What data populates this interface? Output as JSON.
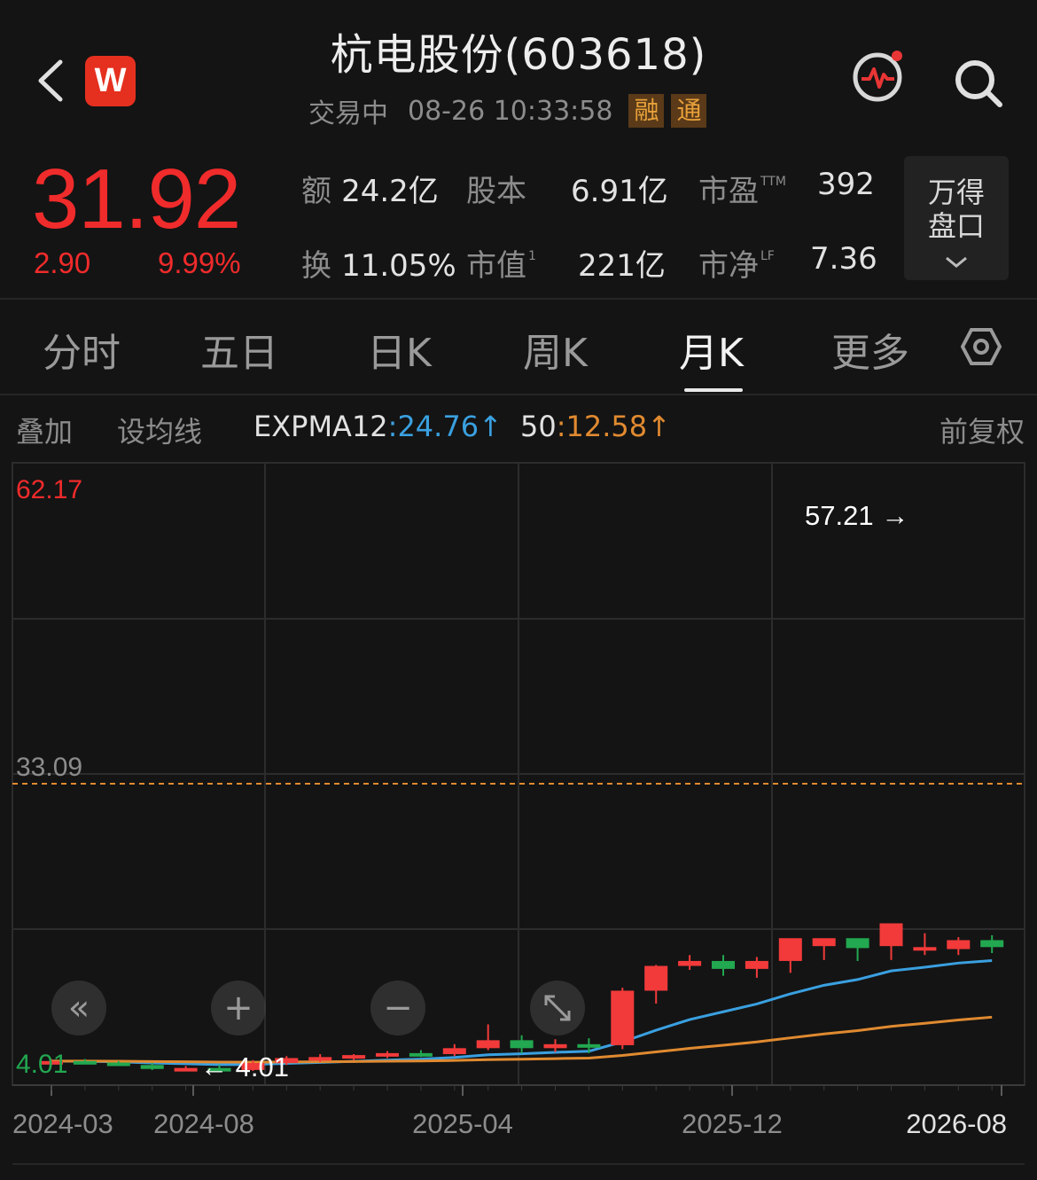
{
  "header": {
    "title": "杭电股份(603618)",
    "status": "交易中",
    "datetime": "08-26 10:33:58",
    "tags": [
      "融",
      "通"
    ],
    "logo_letter": "W"
  },
  "quote": {
    "price": "31.92",
    "change": "2.90",
    "change_pct": "9.99%",
    "stats": {
      "amount_label": "额",
      "amount": "24.2亿",
      "share_label": "股本",
      "share": "6.91亿",
      "pe_label": "市盈",
      "pe_sup": "TTM",
      "pe": "392",
      "turnover_label": "换",
      "turnover": "11.05%",
      "mcap_label": "市值",
      "mcap_sup": "1",
      "mcap": "221亿",
      "pb_label": "市净",
      "pb_sup": "LF",
      "pb": "7.36"
    },
    "panel_button": [
      "万得",
      "盘口"
    ]
  },
  "tabs": [
    "分时",
    "五日",
    "日K",
    "周K",
    "月K",
    "更多"
  ],
  "active_tab": "月K",
  "indicator_row": {
    "overlay": "叠加",
    "set_ma": "设均线",
    "ema12_label": "EXPMA12",
    "ema12_value": "24.76",
    "ema50_label": "50",
    "ema50_value": "12.58",
    "adjust": "前复权",
    "ema12_color": "#3aa0e0",
    "ema50_color": "#e08a30"
  },
  "chart_data": {
    "type": "candlestick",
    "period": "monthly",
    "y_top_label": "62.17",
    "current_price_line": "33.09",
    "y_bottom_label": "4.01",
    "high_marker": "57.21 →",
    "low_marker": "← 4.01",
    "x_labels": [
      "2024-03",
      "2024-08",
      "2025-04",
      "2025-12",
      "2026-08"
    ],
    "ylim": [
      4.01,
      62.17
    ],
    "colors": {
      "up": "#f23a3a",
      "down": "#22a850",
      "ema12": "#3aa0e0",
      "ema50": "#e08a30"
    },
    "candles": [
      {
        "o": 5.0,
        "h": 5.3,
        "l": 4.7,
        "c": 5.1
      },
      {
        "o": 5.1,
        "h": 5.3,
        "l": 4.8,
        "c": 4.95
      },
      {
        "o": 4.95,
        "h": 5.1,
        "l": 4.6,
        "c": 4.7
      },
      {
        "o": 4.7,
        "h": 4.9,
        "l": 4.2,
        "c": 4.3
      },
      {
        "o": 4.3,
        "h": 4.6,
        "l": 4.1,
        "c": 4.4
      },
      {
        "o": 4.4,
        "h": 4.7,
        "l": 4.01,
        "c": 4.2
      },
      {
        "o": 4.2,
        "h": 5.2,
        "l": 4.1,
        "c": 4.9
      },
      {
        "o": 4.9,
        "h": 5.6,
        "l": 4.7,
        "c": 5.4
      },
      {
        "o": 5.4,
        "h": 5.8,
        "l": 5.0,
        "c": 5.5
      },
      {
        "o": 5.5,
        "h": 5.8,
        "l": 5.2,
        "c": 5.7
      },
      {
        "o": 5.7,
        "h": 6.1,
        "l": 5.4,
        "c": 5.9
      },
      {
        "o": 5.9,
        "h": 6.2,
        "l": 5.5,
        "c": 5.8
      },
      {
        "o": 5.8,
        "h": 6.8,
        "l": 5.6,
        "c": 6.4
      },
      {
        "o": 6.4,
        "h": 8.8,
        "l": 6.2,
        "c": 7.2
      },
      {
        "o": 7.2,
        "h": 7.7,
        "l": 5.9,
        "c": 6.4
      },
      {
        "o": 6.4,
        "h": 7.3,
        "l": 6.0,
        "c": 6.8
      },
      {
        "o": 6.8,
        "h": 7.4,
        "l": 5.9,
        "c": 6.7
      },
      {
        "o": 6.7,
        "h": 12.5,
        "l": 6.3,
        "c": 12.2
      },
      {
        "o": 12.2,
        "h": 14.8,
        "l": 10.9,
        "c": 14.7
      },
      {
        "o": 14.7,
        "h": 15.8,
        "l": 14.3,
        "c": 15.2
      },
      {
        "o": 15.2,
        "h": 15.8,
        "l": 13.7,
        "c": 14.4
      },
      {
        "o": 14.4,
        "h": 15.6,
        "l": 13.5,
        "c": 15.2
      },
      {
        "o": 15.2,
        "h": 16.5,
        "l": 14.0,
        "c": 17.5
      },
      {
        "o": 16.7,
        "h": 16.9,
        "l": 15.3,
        "c": 17.5
      },
      {
        "o": 17.5,
        "h": 16.6,
        "l": 15.2,
        "c": 16.5
      },
      {
        "o": 16.7,
        "h": 18.2,
        "l": 15.3,
        "c": 19.0
      },
      {
        "o": 16.3,
        "h": 18.0,
        "l": 15.8,
        "c": 16.6
      },
      {
        "o": 16.4,
        "h": 17.6,
        "l": 15.8,
        "c": 17.3
      },
      {
        "o": 17.3,
        "h": 17.8,
        "l": 16.0,
        "c": 16.6
      }
    ]
  }
}
